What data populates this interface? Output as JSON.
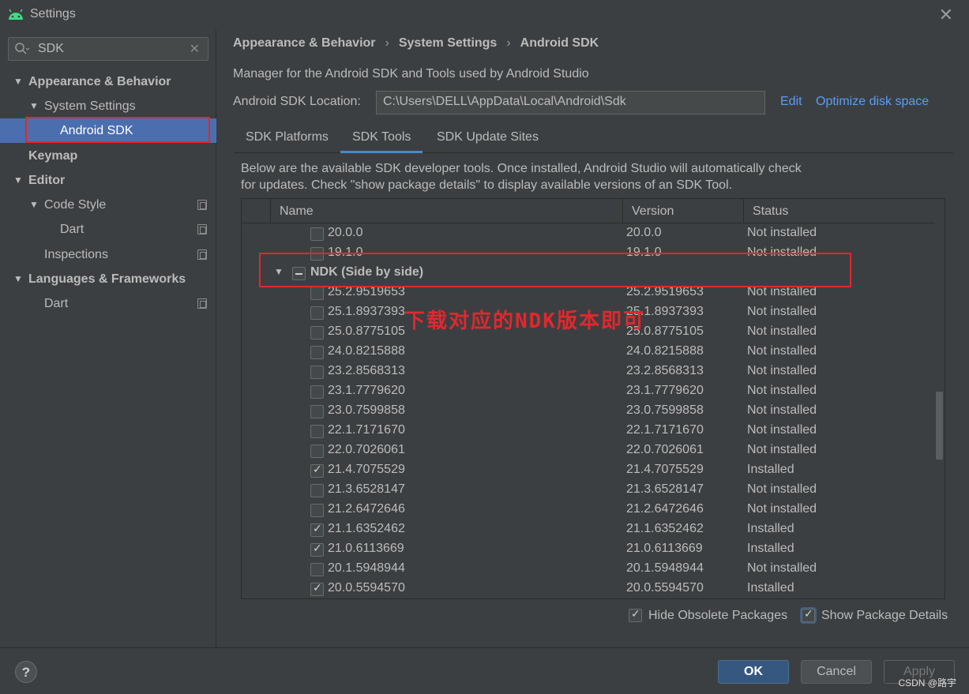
{
  "window": {
    "title": "Settings"
  },
  "search": {
    "value": "SDK"
  },
  "sidebar": {
    "items": [
      {
        "label": "Appearance & Behavior"
      },
      {
        "label": "System Settings"
      },
      {
        "label": "Android SDK"
      },
      {
        "label": "Keymap"
      },
      {
        "label": "Editor"
      },
      {
        "label": "Code Style"
      },
      {
        "label": "Dart"
      },
      {
        "label": "Inspections"
      },
      {
        "label": "Languages & Frameworks"
      },
      {
        "label": "Dart"
      }
    ]
  },
  "breadcrumb": [
    "Appearance & Behavior",
    "System Settings",
    "Android SDK"
  ],
  "description": "Manager for the Android SDK and Tools used by Android Studio",
  "sdk_location": {
    "label": "Android SDK Location:",
    "value": "C:\\Users\\DELL\\AppData\\Local\\Android\\Sdk",
    "edit_label": "Edit",
    "optimize_label": "Optimize disk space"
  },
  "tabs": [
    "SDK Platforms",
    "SDK Tools",
    "SDK Update Sites"
  ],
  "active_tab": "SDK Tools",
  "note_line1": "Below are the available SDK developer tools. Once installed, Android Studio will automatically check",
  "note_line2": "for updates. Check \"show package details\" to display available versions of an SDK Tool.",
  "table": {
    "headers": [
      "Name",
      "Version",
      "Status"
    ],
    "group": {
      "name": "NDK (Side by side)"
    },
    "rows_before": [
      {
        "name": "20.0.0",
        "version": "20.0.0",
        "status": "Not installed",
        "checked": false
      },
      {
        "name": "19.1.0",
        "version": "19.1.0",
        "status": "Not installed",
        "checked": false
      }
    ],
    "rows": [
      {
        "name": "25.2.9519653",
        "version": "25.2.9519653",
        "status": "Not installed",
        "checked": false
      },
      {
        "name": "25.1.8937393",
        "version": "25.1.8937393",
        "status": "Not installed",
        "checked": false
      },
      {
        "name": "25.0.8775105",
        "version": "25.0.8775105",
        "status": "Not installed",
        "checked": false
      },
      {
        "name": "24.0.8215888",
        "version": "24.0.8215888",
        "status": "Not installed",
        "checked": false
      },
      {
        "name": "23.2.8568313",
        "version": "23.2.8568313",
        "status": "Not installed",
        "checked": false
      },
      {
        "name": "23.1.7779620",
        "version": "23.1.7779620",
        "status": "Not installed",
        "checked": false
      },
      {
        "name": "23.0.7599858",
        "version": "23.0.7599858",
        "status": "Not installed",
        "checked": false
      },
      {
        "name": "22.1.7171670",
        "version": "22.1.7171670",
        "status": "Not installed",
        "checked": false
      },
      {
        "name": "22.0.7026061",
        "version": "22.0.7026061",
        "status": "Not installed",
        "checked": false
      },
      {
        "name": "21.4.7075529",
        "version": "21.4.7075529",
        "status": "Installed",
        "checked": true
      },
      {
        "name": "21.3.6528147",
        "version": "21.3.6528147",
        "status": "Not installed",
        "checked": false
      },
      {
        "name": "21.2.6472646",
        "version": "21.2.6472646",
        "status": "Not installed",
        "checked": false
      },
      {
        "name": "21.1.6352462",
        "version": "21.1.6352462",
        "status": "Installed",
        "checked": true
      },
      {
        "name": "21.0.6113669",
        "version": "21.0.6113669",
        "status": "Installed",
        "checked": true
      },
      {
        "name": "20.1.5948944",
        "version": "20.1.5948944",
        "status": "Not installed",
        "checked": false
      },
      {
        "name": "20.0.5594570",
        "version": "20.0.5594570",
        "status": "Installed",
        "checked": true
      }
    ]
  },
  "annotation": "下载对应的NDK版本即可",
  "options": {
    "hide_obsolete": "Hide Obsolete Packages",
    "show_details": "Show Package Details"
  },
  "buttons": {
    "help": "?",
    "ok": "OK",
    "cancel": "Cancel",
    "apply": "Apply"
  },
  "watermark": "CSDN @路宇",
  "colors": {
    "accent": "#4b6eaf",
    "link": "#589df6",
    "annotation": "#e0282e"
  }
}
